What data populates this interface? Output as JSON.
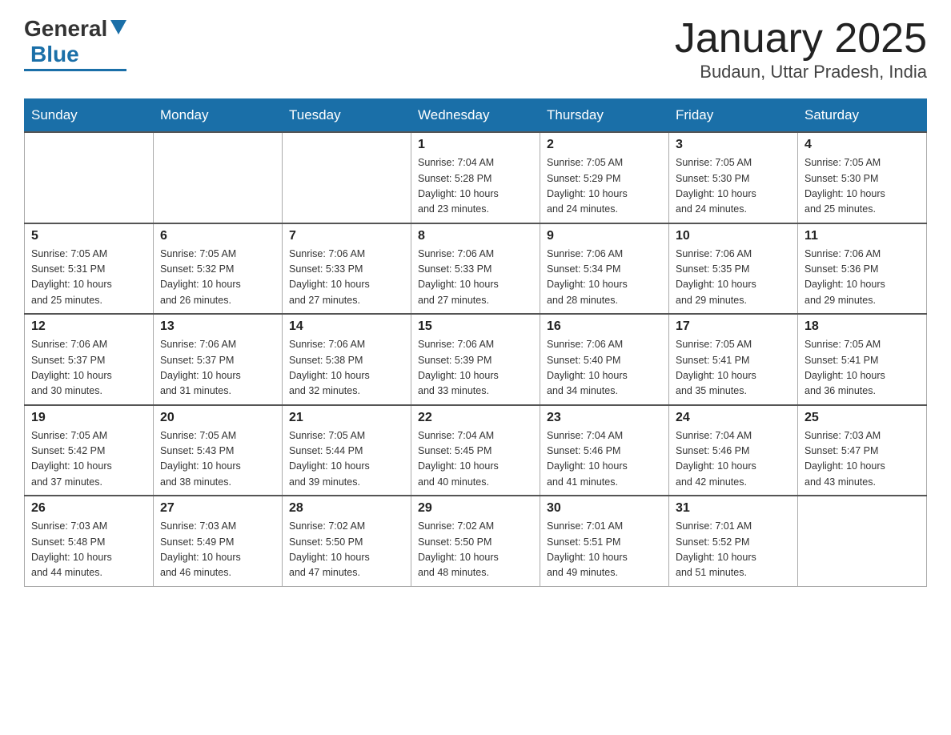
{
  "header": {
    "logo_text_general": "General",
    "logo_text_blue": "Blue",
    "month_title": "January 2025",
    "location": "Budaun, Uttar Pradesh, India"
  },
  "days_of_week": [
    "Sunday",
    "Monday",
    "Tuesday",
    "Wednesday",
    "Thursday",
    "Friday",
    "Saturday"
  ],
  "weeks": [
    [
      {
        "day": "",
        "info": ""
      },
      {
        "day": "",
        "info": ""
      },
      {
        "day": "",
        "info": ""
      },
      {
        "day": "1",
        "info": "Sunrise: 7:04 AM\nSunset: 5:28 PM\nDaylight: 10 hours\nand 23 minutes."
      },
      {
        "day": "2",
        "info": "Sunrise: 7:05 AM\nSunset: 5:29 PM\nDaylight: 10 hours\nand 24 minutes."
      },
      {
        "day": "3",
        "info": "Sunrise: 7:05 AM\nSunset: 5:30 PM\nDaylight: 10 hours\nand 24 minutes."
      },
      {
        "day": "4",
        "info": "Sunrise: 7:05 AM\nSunset: 5:30 PM\nDaylight: 10 hours\nand 25 minutes."
      }
    ],
    [
      {
        "day": "5",
        "info": "Sunrise: 7:05 AM\nSunset: 5:31 PM\nDaylight: 10 hours\nand 25 minutes."
      },
      {
        "day": "6",
        "info": "Sunrise: 7:05 AM\nSunset: 5:32 PM\nDaylight: 10 hours\nand 26 minutes."
      },
      {
        "day": "7",
        "info": "Sunrise: 7:06 AM\nSunset: 5:33 PM\nDaylight: 10 hours\nand 27 minutes."
      },
      {
        "day": "8",
        "info": "Sunrise: 7:06 AM\nSunset: 5:33 PM\nDaylight: 10 hours\nand 27 minutes."
      },
      {
        "day": "9",
        "info": "Sunrise: 7:06 AM\nSunset: 5:34 PM\nDaylight: 10 hours\nand 28 minutes."
      },
      {
        "day": "10",
        "info": "Sunrise: 7:06 AM\nSunset: 5:35 PM\nDaylight: 10 hours\nand 29 minutes."
      },
      {
        "day": "11",
        "info": "Sunrise: 7:06 AM\nSunset: 5:36 PM\nDaylight: 10 hours\nand 29 minutes."
      }
    ],
    [
      {
        "day": "12",
        "info": "Sunrise: 7:06 AM\nSunset: 5:37 PM\nDaylight: 10 hours\nand 30 minutes."
      },
      {
        "day": "13",
        "info": "Sunrise: 7:06 AM\nSunset: 5:37 PM\nDaylight: 10 hours\nand 31 minutes."
      },
      {
        "day": "14",
        "info": "Sunrise: 7:06 AM\nSunset: 5:38 PM\nDaylight: 10 hours\nand 32 minutes."
      },
      {
        "day": "15",
        "info": "Sunrise: 7:06 AM\nSunset: 5:39 PM\nDaylight: 10 hours\nand 33 minutes."
      },
      {
        "day": "16",
        "info": "Sunrise: 7:06 AM\nSunset: 5:40 PM\nDaylight: 10 hours\nand 34 minutes."
      },
      {
        "day": "17",
        "info": "Sunrise: 7:05 AM\nSunset: 5:41 PM\nDaylight: 10 hours\nand 35 minutes."
      },
      {
        "day": "18",
        "info": "Sunrise: 7:05 AM\nSunset: 5:41 PM\nDaylight: 10 hours\nand 36 minutes."
      }
    ],
    [
      {
        "day": "19",
        "info": "Sunrise: 7:05 AM\nSunset: 5:42 PM\nDaylight: 10 hours\nand 37 minutes."
      },
      {
        "day": "20",
        "info": "Sunrise: 7:05 AM\nSunset: 5:43 PM\nDaylight: 10 hours\nand 38 minutes."
      },
      {
        "day": "21",
        "info": "Sunrise: 7:05 AM\nSunset: 5:44 PM\nDaylight: 10 hours\nand 39 minutes."
      },
      {
        "day": "22",
        "info": "Sunrise: 7:04 AM\nSunset: 5:45 PM\nDaylight: 10 hours\nand 40 minutes."
      },
      {
        "day": "23",
        "info": "Sunrise: 7:04 AM\nSunset: 5:46 PM\nDaylight: 10 hours\nand 41 minutes."
      },
      {
        "day": "24",
        "info": "Sunrise: 7:04 AM\nSunset: 5:46 PM\nDaylight: 10 hours\nand 42 minutes."
      },
      {
        "day": "25",
        "info": "Sunrise: 7:03 AM\nSunset: 5:47 PM\nDaylight: 10 hours\nand 43 minutes."
      }
    ],
    [
      {
        "day": "26",
        "info": "Sunrise: 7:03 AM\nSunset: 5:48 PM\nDaylight: 10 hours\nand 44 minutes."
      },
      {
        "day": "27",
        "info": "Sunrise: 7:03 AM\nSunset: 5:49 PM\nDaylight: 10 hours\nand 46 minutes."
      },
      {
        "day": "28",
        "info": "Sunrise: 7:02 AM\nSunset: 5:50 PM\nDaylight: 10 hours\nand 47 minutes."
      },
      {
        "day": "29",
        "info": "Sunrise: 7:02 AM\nSunset: 5:50 PM\nDaylight: 10 hours\nand 48 minutes."
      },
      {
        "day": "30",
        "info": "Sunrise: 7:01 AM\nSunset: 5:51 PM\nDaylight: 10 hours\nand 49 minutes."
      },
      {
        "day": "31",
        "info": "Sunrise: 7:01 AM\nSunset: 5:52 PM\nDaylight: 10 hours\nand 51 minutes."
      },
      {
        "day": "",
        "info": ""
      }
    ]
  ]
}
